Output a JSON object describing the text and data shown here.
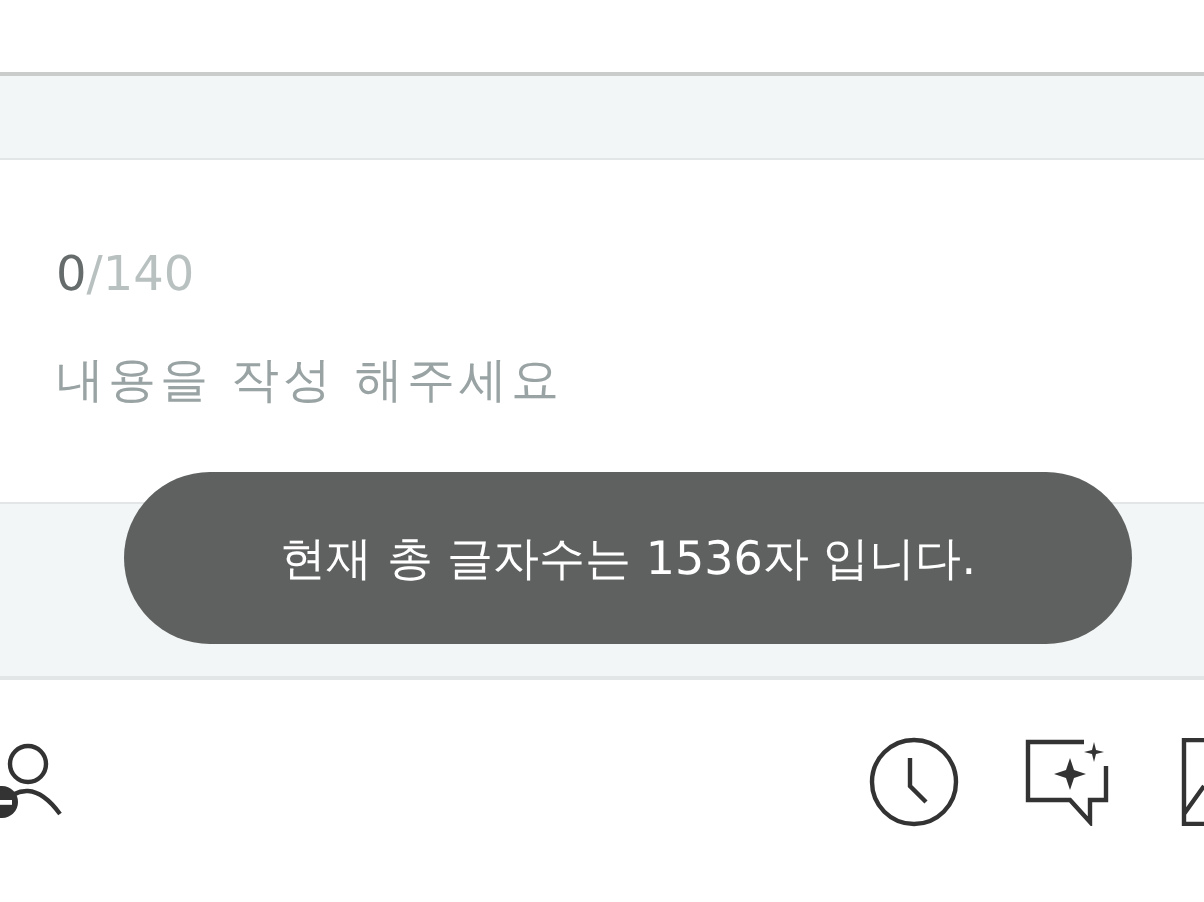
{
  "composer": {
    "count": "0",
    "limit": "/140",
    "placeholder": "내용을 작성 해주세요"
  },
  "toast": {
    "message": "현재 총 글자수는 1536자 입니다."
  }
}
